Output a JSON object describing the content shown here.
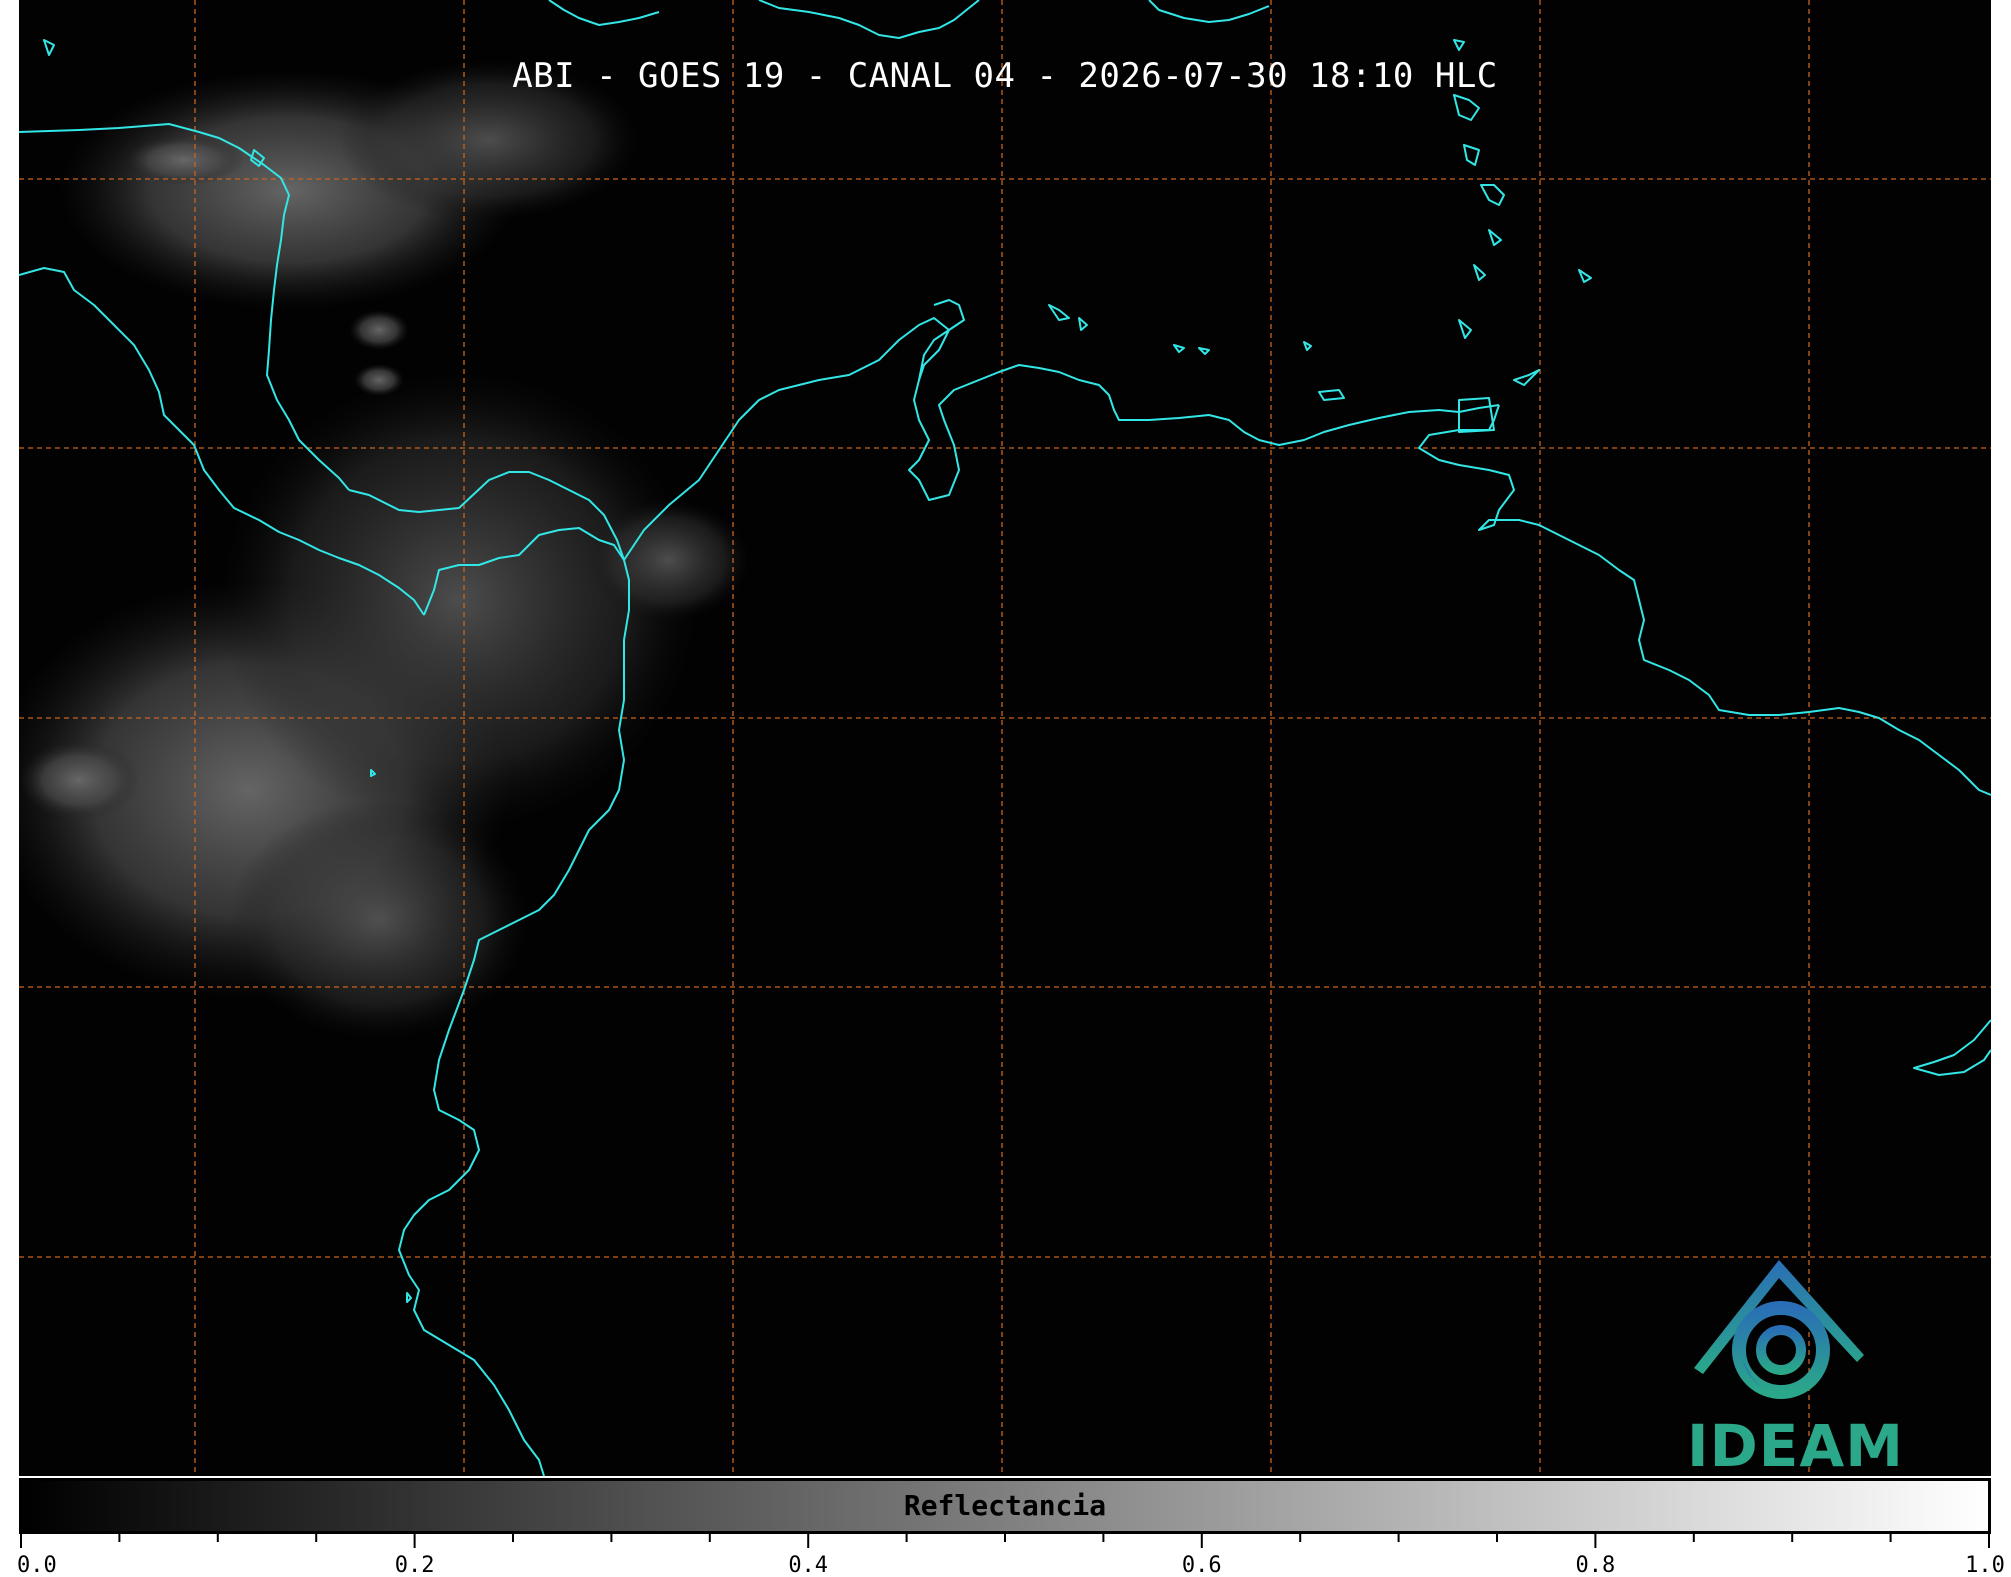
{
  "title": "ABI - GOES 19 - CANAL 04 - 2026-07-30 18:10 HLC",
  "logo": {
    "text": "IDEAM",
    "icon": "ideam-logo-icon",
    "colors": [
      "#2a6fb5",
      "#2aa889"
    ]
  },
  "colorbar": {
    "label": "Reflectancia",
    "min": 0.0,
    "max": 1.0,
    "major_ticks": [
      "0.0",
      "0.2",
      "0.4",
      "0.6",
      "0.8",
      "1.0"
    ],
    "minor_step": 0.05,
    "colormap": "gray"
  },
  "map": {
    "coastline_color": "#33e6e6",
    "grid_color": "#c8641e",
    "grid_style": "dashed",
    "background_color": "#020202"
  }
}
